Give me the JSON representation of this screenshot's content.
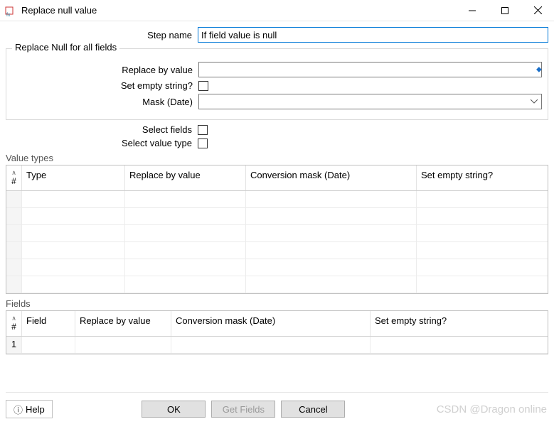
{
  "window": {
    "title": "Replace null value"
  },
  "form": {
    "step_name_label": "Step name",
    "step_name_value": "If field value is null",
    "fieldset_title": "Replace Null for all fields",
    "replace_by_label": "Replace by value",
    "replace_by_value": "",
    "set_empty_label": "Set empty string?",
    "mask_label": "Mask (Date)",
    "mask_value": "",
    "select_fields_label": "Select fields",
    "select_value_type_label": "Select value type"
  },
  "value_types": {
    "section_label": "Value types",
    "headers": {
      "num": "#",
      "type": "Type",
      "replace": "Replace by value",
      "mask": "Conversion mask (Date)",
      "setempty": "Set empty string?"
    },
    "rows": [
      "",
      "",
      "",
      "",
      "",
      ""
    ]
  },
  "fields": {
    "section_label": "Fields",
    "headers": {
      "num": "#",
      "field": "Field",
      "replace": "Replace by value",
      "mask": "Conversion mask (Date)",
      "setempty": "Set empty string?"
    },
    "rows": [
      {
        "num": "1",
        "field": "",
        "replace": "",
        "mask": "",
        "setempty": ""
      }
    ]
  },
  "buttons": {
    "help": "Help",
    "ok": "OK",
    "get_fields": "Get Fields",
    "cancel": "Cancel"
  },
  "watermark": "CSDN @Dragon online"
}
